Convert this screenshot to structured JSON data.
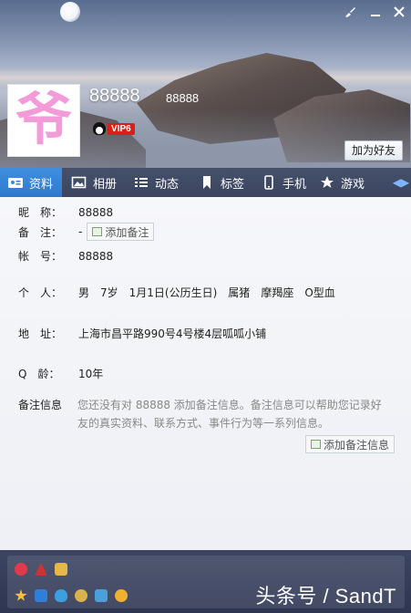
{
  "header": {
    "avatar_char": "爷",
    "nickname": "88888",
    "nickname_sub": "88888",
    "vip_label": "VIP6",
    "add_friend": "加为好友",
    "window_controls": [
      "brush-icon",
      "minimize-icon",
      "close-icon"
    ]
  },
  "tabs": [
    {
      "label": "资料",
      "icon": "profile-card-icon",
      "active": true
    },
    {
      "label": "相册",
      "icon": "album-icon"
    },
    {
      "label": "动态",
      "icon": "feed-list-icon"
    },
    {
      "label": "标签",
      "icon": "bookmark-icon"
    },
    {
      "label": "手机",
      "icon": "phone-icon"
    },
    {
      "label": "游戏",
      "icon": "game-icon"
    }
  ],
  "profile": {
    "nickname_label": "昵　称：",
    "nickname_value": "88888",
    "remark_label": "备　注：",
    "remark_value": "-",
    "add_remark": "添加备注",
    "account_label": "帐　号：",
    "account_value": "88888",
    "personal_label": "个　人：",
    "personal": [
      "男",
      "7岁",
      "1月1日(公历生日)",
      "属猪",
      "摩羯座",
      "O型血"
    ],
    "address_label": "地　址：",
    "address_value": "上海市昌平路990号4号楼4层呱呱小铺",
    "qage_label": "Q　龄：",
    "qage_value": "10年",
    "note_info_label": "备注信息",
    "note_info_desc": "您还没有对 88888 添加备注信息。备注信息可以帮助您记录好友的真实资料、联系方式、事件行为等一系列信息。",
    "add_note_info": "添加备注信息"
  },
  "watermark": "头条号 / SandT",
  "colors": {
    "tab_active": "#3a88dc",
    "tabbar": "#414b66",
    "vip_red": "#d8201a",
    "avatar_pink": "#f39ad8"
  }
}
